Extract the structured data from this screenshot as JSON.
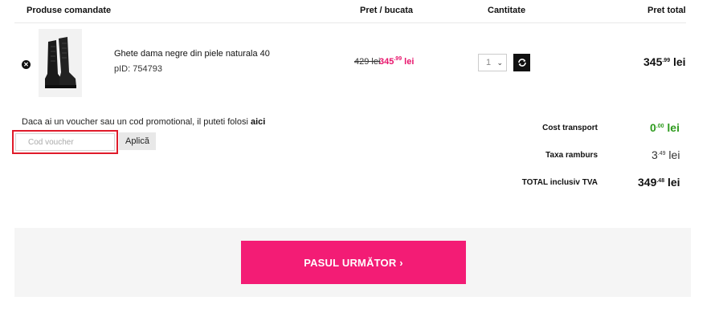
{
  "table": {
    "headers": {
      "products": "Produse comandate",
      "unit_price": "Pret / bucata",
      "quantity": "Cantitate",
      "total_price": "Pret total"
    }
  },
  "item": {
    "name": "Ghete dama negre din piele naturala 40",
    "pid": "pID: 754793",
    "old_price": "429 lei",
    "new_price_main": "345",
    "new_price_cents": ".99",
    "new_price_currency": "lei",
    "quantity": "1",
    "total_main": "345",
    "total_cents": ".99",
    "total_currency": "lei"
  },
  "voucher": {
    "text": "Daca ai un voucher sau un cod promotional, il puteti folosi",
    "link": "aici",
    "placeholder": "Cod voucher",
    "apply_label": "Aplică"
  },
  "summary": {
    "transport_label": "Cost transport",
    "transport_main": "0",
    "transport_cents": ".00",
    "transport_currency": "lei",
    "rambursement_label": "Taxa ramburs",
    "rambursement_main": "3",
    "rambursement_cents": ".49",
    "rambursement_currency": "lei",
    "total_label": "TOTAL inclusiv TVA",
    "total_main": "349",
    "total_cents": ".48",
    "total_currency": "lei"
  },
  "next_button": {
    "label": "PASUL URMĂTOR ›"
  },
  "colors": {
    "accent": "#f31c75",
    "sale_price": "#e8156c",
    "free_shipping": "#2e9b1e",
    "highlight_border": "#e01b2a"
  }
}
